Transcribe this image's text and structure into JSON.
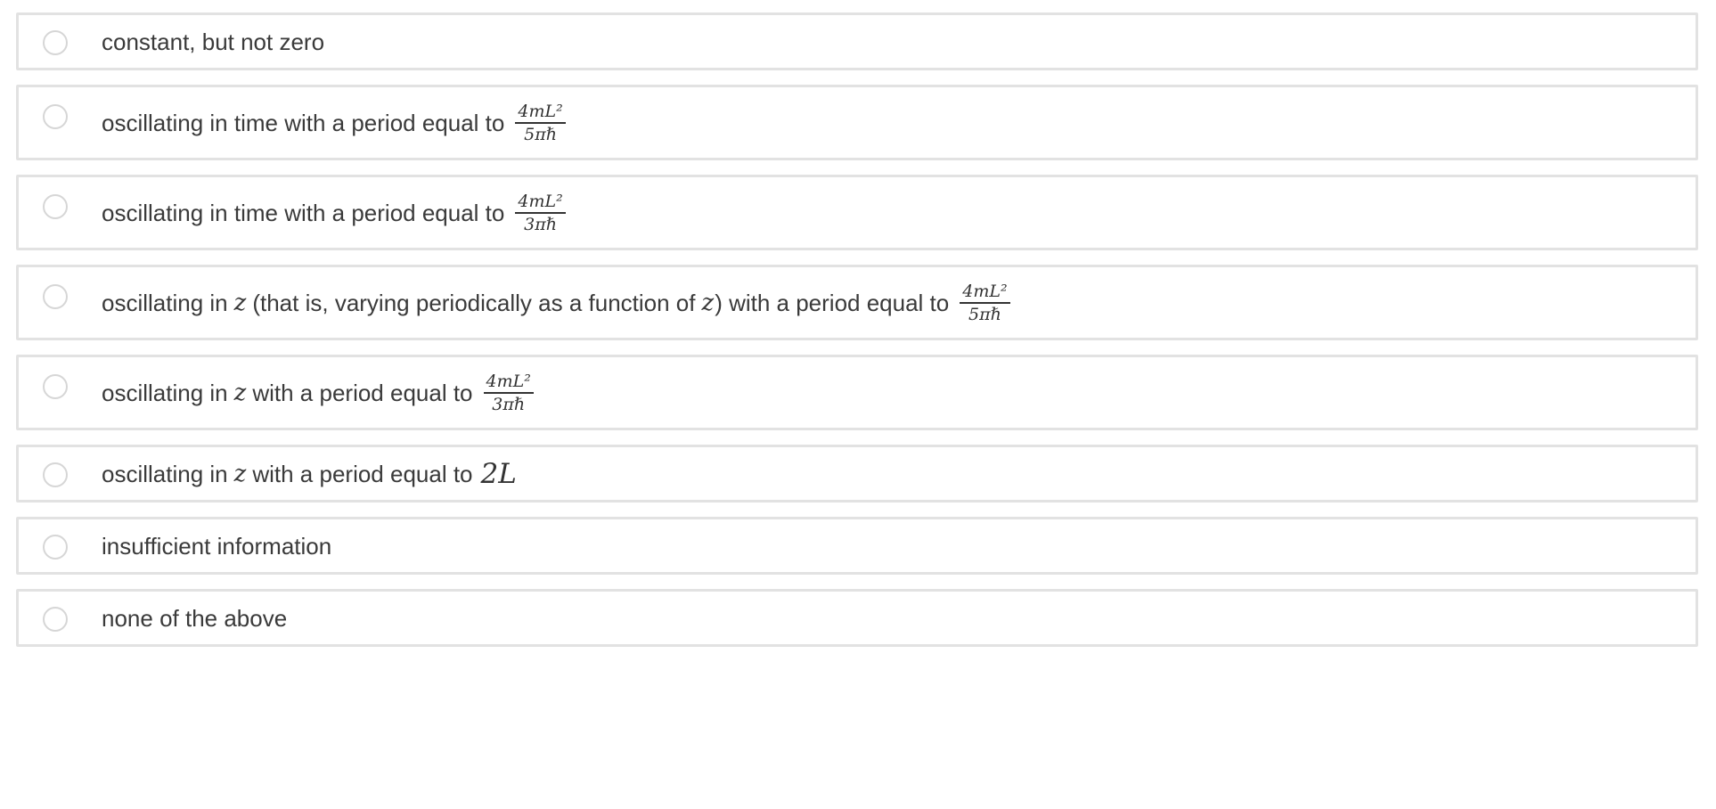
{
  "question": {
    "options": [
      {
        "label": "constant, but not zero",
        "selected": false
      },
      {
        "prefix": "oscillating in time with a period equal to",
        "numerator": "4mL²",
        "denominator": "5πℏ",
        "selected": false
      },
      {
        "prefix": "oscillating in time with a period equal to",
        "numerator": "4mL²",
        "denominator": "3πℏ",
        "selected": false
      },
      {
        "prefix": "oscillating in",
        "var1": "z",
        "middle": "(that is, varying periodically as a function of",
        "var2": "z",
        "suffix": ") with a period equal to",
        "numerator": "4mL²",
        "denominator": "5πℏ",
        "selected": false
      },
      {
        "prefix": "oscillating in",
        "var1": "z",
        "suffix": "with a period equal to",
        "numerator": "4mL²",
        "denominator": "3πℏ",
        "selected": false
      },
      {
        "prefix": "oscillating in",
        "var1": "z",
        "suffix": "with a period equal to",
        "math": "2L",
        "selected": false
      },
      {
        "label": "insufficient information",
        "selected": false
      },
      {
        "label": "none of the above",
        "selected": false
      }
    ]
  }
}
